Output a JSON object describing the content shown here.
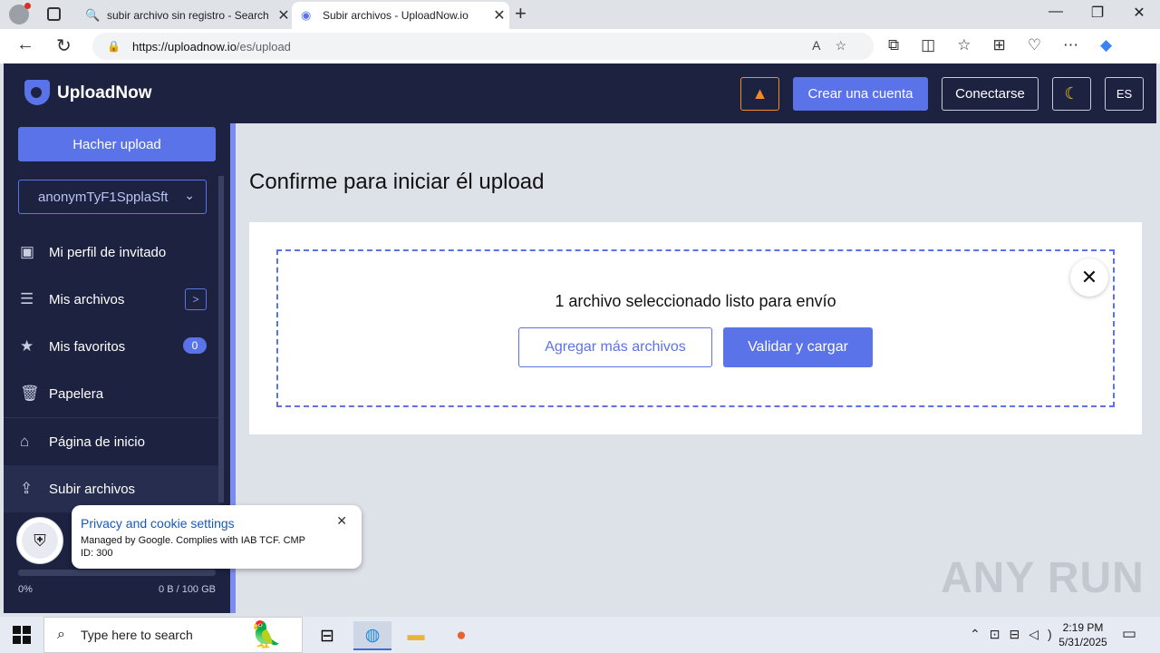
{
  "browser": {
    "tabs": [
      {
        "label": "subir archivo sin registro - Search",
        "icon": "search-icon"
      },
      {
        "label": "Subir archivos - UploadNow.io",
        "icon": "uploadnow-favicon"
      }
    ],
    "url": {
      "domain": "https://uploadnow.io",
      "path": "/es/upload"
    }
  },
  "header": {
    "logo_text": "UploadNow",
    "create_account": "Crear una cuenta",
    "login": "Conectarse",
    "language": "ES"
  },
  "sidebar": {
    "upload_button": "Hacher upload",
    "user_select": "anonymTyF1SpplaSft",
    "items": [
      {
        "label": "Mi perfil de invitado",
        "icon": "user-profile-icon"
      },
      {
        "label": "Mis archivos",
        "icon": "file-tree-icon"
      },
      {
        "label": "Mis favoritos",
        "icon": "star-icon",
        "badge": "0"
      },
      {
        "label": "Papelera",
        "icon": "trash-icon"
      },
      {
        "label": "Página de inicio",
        "icon": "home-icon"
      },
      {
        "label": "Subir archivos",
        "icon": "upload-icon"
      }
    ],
    "quota": {
      "percent": "0%",
      "size": "0 B / 100 GB",
      "fill": 0
    }
  },
  "main": {
    "title": "Confirme para iniciar él upload",
    "status": "1 archivo seleccionado listo para envío",
    "add_more": "Agregar más archivos",
    "validate": "Validar y cargar"
  },
  "cookie": {
    "title": "Privacy and cookie settings",
    "text": "Managed by Google. Complies with IAB TCF. CMP ID: 300"
  },
  "watermark": "ANY RUN",
  "taskbar": {
    "search_placeholder": "Type here to search",
    "time": "2:19 PM",
    "date": "5/31/2025"
  },
  "colors": {
    "accent": "#5b73e8",
    "header_bg": "#1c2240",
    "warning": "#f28c28"
  }
}
